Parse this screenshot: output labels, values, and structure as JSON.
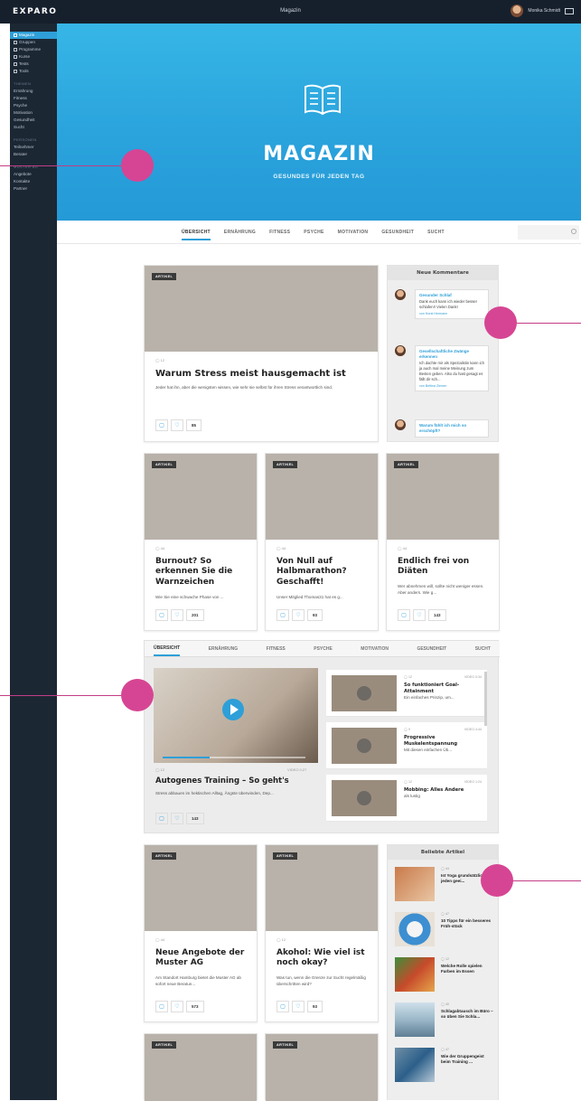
{
  "topbar": {
    "logo": "EXPARO",
    "title": "Magazin",
    "user": "Monika Schmidt"
  },
  "sidebar": {
    "main": [
      "Magazin",
      "Gruppen",
      "Programme",
      "Kurse",
      "Tests",
      "Tools"
    ],
    "themen_head": "THEMEN",
    "themen": [
      "Ernährung",
      "Fitness",
      "Psyche",
      "Motivation",
      "Gesundheit",
      "Sucht"
    ],
    "personen_head": "PERSONEN",
    "personen": [
      "Teilnehmer",
      "Berater"
    ],
    "muster_head": "MUSTER AG",
    "muster": [
      "Angebote",
      "Kontakte",
      "Partner"
    ]
  },
  "hero": {
    "title": "MAGAZIN",
    "subtitle": "GESUNDES FÜR JEDEN TAG"
  },
  "categories": [
    "ÜBERSICHT",
    "ERNÄHRUNG",
    "FITNESS",
    "PSYCHE",
    "MOTIVATION",
    "GESUNDHEIT",
    "SUCHT"
  ],
  "badge": "ARTIKEL",
  "featured": {
    "meta": "◯ 12",
    "title": "Warum Stress meist hausgemacht ist",
    "excerpt": "Jeder hat ihn, aber die wenigsten wissen, wie sehr sie selbst für ihren Stress verantwortlich sind.",
    "likes": "85"
  },
  "comments": {
    "title": "Neue Kommentare",
    "items": [
      {
        "title": "Gesunder Schlaf",
        "body": "Dank euch kann ich wieder besser schlafen!! Vielen Dank!",
        "via": "von",
        "author": "Horst Hermann"
      },
      {
        "title": "Gesellschaftliche Zwänge erkennen",
        "body": "Ich dachte mir als Spezialistin kann ich ja auch mal meine Meinung zum Besten geben. Also du hast gesagt es fällt dir sch...",
        "via": "von",
        "author": "Bettina Ziemer"
      },
      {
        "title": "Warum fühlt ich mich so erschöpft?",
        "body": "",
        "via": "",
        "author": ""
      }
    ]
  },
  "articles_row1": [
    {
      "meta": "◯ 44",
      "title": "Burnout? So erkennen Sie die Warnzeichen",
      "excerpt": "Wie Sie eine schwache Phase von ...",
      "likes": "201"
    },
    {
      "meta": "◯ 44",
      "title": "Von Null auf Halbmarathon? Geschafft!",
      "excerpt": "Unser Mitglied Thomas31 hat es g...",
      "likes": "93"
    },
    {
      "meta": "◯ 44",
      "title": "Endlich frei von Diäten",
      "excerpt": "Wer abnehmen will, sollte nicht weniger essen. Aber anders. Wie g...",
      "likes": "143"
    }
  ],
  "video": {
    "tabs": [
      "ÜBERSICHT",
      "ERNÄHRUNG",
      "FITNESS",
      "PSYCHE",
      "MOTIVATION",
      "GESUNDHEIT",
      "SUCHT"
    ],
    "main": {
      "meta": "◯ 12",
      "type": "VIDEO 0:27",
      "title": "Autogenes Training – So geht's",
      "excerpt": "Stress abbauen im hektischen Alltag, Ängste überwinden, Dep...",
      "likes": "143",
      "progress": 0.33
    },
    "list": [
      {
        "meta": "◯ 12",
        "type": "VIDEO 0:34",
        "title": "So funktioniert Goal-Attainment",
        "sub": "Ein einfaches Prinzip, um..."
      },
      {
        "meta": "◯ 9",
        "type": "VIDEO 4:44",
        "title": "Progressive Muskelentspannung",
        "sub": "Mit diesen einfachen Üb..."
      },
      {
        "meta": "◯ 12",
        "type": "VIDEO 1:24",
        "title": "Mobbing: Alles Andere",
        "sub": "als lustig"
      }
    ]
  },
  "articles_row2": [
    {
      "meta": "◯ 44",
      "title": "Neue Angebote der Muster AG",
      "excerpt": "Am Standort Hamburg bietet die Muster AG ab sofort neue Beratun...",
      "likes": "573"
    },
    {
      "meta": "◯ 12",
      "title": "Akohol: Wie viel ist noch okay?",
      "excerpt": "Was tun, wenn die Grenze zur Sucht regelmäßig überschritten wird?",
      "likes": "93"
    }
  ],
  "popular": {
    "title": "Beliebte Artikel",
    "items": [
      {
        "meta": "◯ 44",
        "title": "Ist Yoga grundsätzlich für jeden geei..."
      },
      {
        "meta": "◯ 47",
        "title": "10 Tipps für ein besseres Früh-stück"
      },
      {
        "meta": "◯ 12",
        "title": "Welche Rolle spielen Farben im Essen"
      },
      {
        "meta": "◯ 40",
        "title": "Schlagabtausch im Büro – so üben Sie Schla..."
      },
      {
        "meta": "◯ 47",
        "title": "Wie der Gruppengeist beim Training ..."
      }
    ]
  },
  "colors": {
    "accent": "#2e9fd8",
    "callout": "#d64593",
    "sidebar": "#1c2734"
  }
}
